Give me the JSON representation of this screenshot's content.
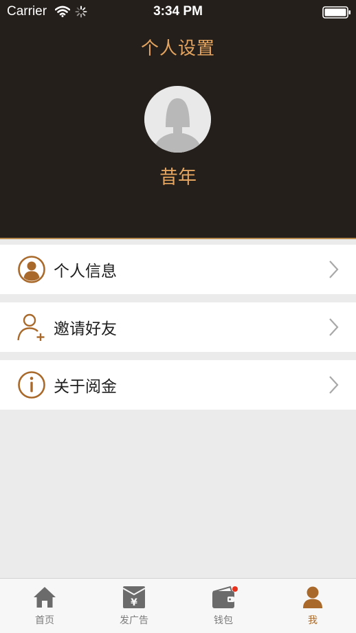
{
  "status_bar": {
    "carrier": "Carrier",
    "time": "3:34 PM"
  },
  "header": {
    "title": "个人设置",
    "username": "昔年"
  },
  "menu": [
    {
      "label": "个人信息",
      "icon": "user-circle-icon"
    },
    {
      "label": "邀请好友",
      "icon": "add-user-icon"
    },
    {
      "label": "关于阅金",
      "icon": "info-icon"
    }
  ],
  "tabbar": {
    "tabs": [
      {
        "label": "首页",
        "icon": "home-icon"
      },
      {
        "label": "发广告",
        "icon": "yen-envelope-icon"
      },
      {
        "label": "钱包",
        "icon": "wallet-icon"
      },
      {
        "label": "我",
        "icon": "person-icon",
        "active": true
      }
    ]
  },
  "colors": {
    "header_bg": "#251f1b",
    "accent": "#e3a45f",
    "icon_brown": "#a9692a",
    "notification_dot": "#e8321e"
  }
}
